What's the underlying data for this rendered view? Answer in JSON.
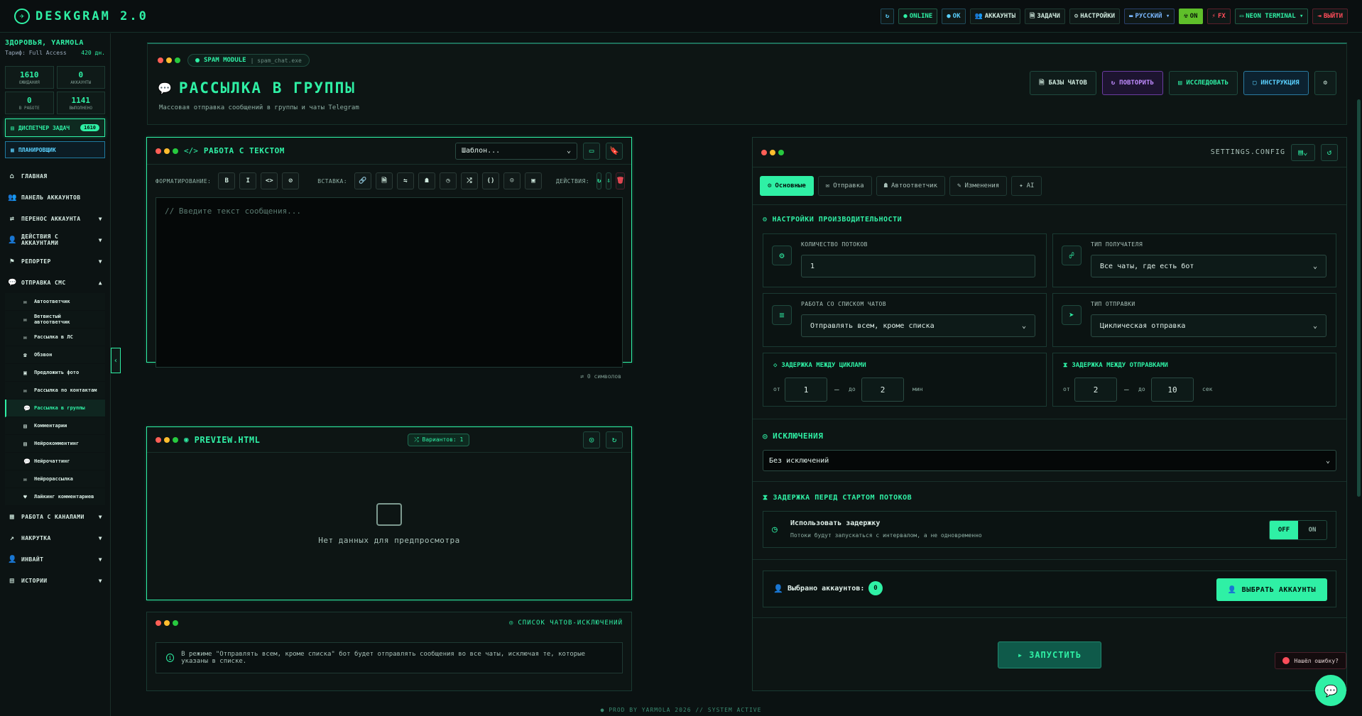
{
  "app": {
    "logo_mark": "✈",
    "title": "DESKGRAM 2.0"
  },
  "topbar": {
    "items": [
      {
        "icon": "↻",
        "label": "",
        "style": "blue",
        "name": "refresh-button"
      },
      {
        "icon": "●",
        "label": "ONLINE",
        "style": "green",
        "name": "online-status"
      },
      {
        "icon": "●",
        "label": "OK",
        "style": "blue",
        "name": "ok-status"
      },
      {
        "icon": "👥",
        "label": "АККАУНТЫ",
        "style": "",
        "name": "accounts-button"
      },
      {
        "icon": "🗎",
        "label": "ЗАДАЧИ",
        "style": "",
        "name": "tasks-button"
      },
      {
        "icon": "⚙",
        "label": "НАСТРОЙКИ",
        "style": "",
        "name": "settings-button"
      },
      {
        "icon": "▬",
        "label": "РУССКИЙ ▾",
        "style": "blue2",
        "name": "language-select"
      },
      {
        "icon": "☢",
        "label": "ON",
        "style": "lime",
        "name": "mode-toggle"
      },
      {
        "icon": "⚡",
        "label": "FX",
        "style": "red",
        "name": "fx-toggle"
      },
      {
        "icon": "▭",
        "label": "NEON TERMINAL ▾",
        "style": "green",
        "name": "theme-select"
      },
      {
        "icon": "⇥",
        "label": "ВЫЙТИ",
        "style": "red",
        "name": "logout-button"
      }
    ]
  },
  "sidebar": {
    "user_name": "ЗДОРОВЬЯ, YARMOLA",
    "plan": "Тариф: Full Access",
    "days": "420 дн.",
    "stats": [
      {
        "value": "1610",
        "label": "ОЖИДАНИЯ"
      },
      {
        "value": "0",
        "label": "АККАУНТЫ"
      },
      {
        "value": "0",
        "label": "В РАБОТЕ"
      },
      {
        "value": "1141",
        "label": "ВЫПОЛНЕНО"
      }
    ],
    "dispatcher": {
      "label": "ДИСПЕТЧЕР ЗАДАЧ",
      "badge": "1610"
    },
    "planner": {
      "label": "ПЛАНИРОВЩИК"
    },
    "nav_top": [
      {
        "icon": "⌂",
        "label": "ГЛАВНАЯ",
        "chevron": ""
      },
      {
        "icon": "👥",
        "label": "ПАНЕЛЬ АККАУНТОВ",
        "chevron": ""
      },
      {
        "icon": "⇄",
        "label": "ПЕРЕНОС АККАУНТА",
        "chevron": "▼"
      },
      {
        "icon": "👤",
        "label": "ДЕЙСТВИЯ С АККАУНТАМИ",
        "chevron": "▼"
      },
      {
        "icon": "⚑",
        "label": "РЕПОРТЕР",
        "chevron": "▼"
      },
      {
        "icon": "💬",
        "label": "ОТПРАВКА СМС",
        "chevron": "▲"
      }
    ],
    "sub_items": [
      {
        "icon": "✉",
        "label": "Автоответчик",
        "active": false
      },
      {
        "icon": "✉",
        "label": "Ветвистый автоответчик",
        "active": false
      },
      {
        "icon": "✉",
        "label": "Рассылка в ЛС",
        "active": false
      },
      {
        "icon": "☎",
        "label": "Обзвон",
        "active": false
      },
      {
        "icon": "▣",
        "label": "Предложить фото",
        "active": false
      },
      {
        "icon": "✉",
        "label": "Рассылка по контактам",
        "active": false
      },
      {
        "icon": "💬",
        "label": "Рассылка в группы",
        "active": true
      },
      {
        "icon": "▤",
        "label": "Комментарии",
        "active": false
      },
      {
        "icon": "▤",
        "label": "Нейрокомментинг",
        "active": false
      },
      {
        "icon": "💬",
        "label": "Нейрочаттинг",
        "active": false
      },
      {
        "icon": "✉",
        "label": "Нейрорассылка",
        "active": false
      },
      {
        "icon": "♥",
        "label": "Лайкинг комментариев",
        "active": false
      }
    ],
    "nav_bottom": [
      {
        "icon": "▦",
        "label": "РАБОТА С КАНАЛАМИ",
        "chevron": "▼"
      },
      {
        "icon": "↗",
        "label": "НАКРУТКА",
        "chevron": "▼"
      },
      {
        "icon": "👤",
        "label": "ИНВАЙТ",
        "chevron": "▼"
      },
      {
        "icon": "▤",
        "label": "ИСТОРИИ",
        "chevron": "▼"
      }
    ]
  },
  "header": {
    "module_label": "SPAM MODULE",
    "module_file": "spam_chat.exe",
    "title": "РАССЫЛКА В ГРУППЫ",
    "subtitle": "Массовая отправка сообщений в группы и чаты Telegram",
    "buttons": [
      {
        "icon": "🗎",
        "label": "БАЗЫ ЧАТОВ",
        "style": ""
      },
      {
        "icon": "↻",
        "label": "ПОВТОРИТЬ",
        "style": "purple"
      },
      {
        "icon": "▤",
        "label": "ИССЛЕДОВАТЬ",
        "style": "green"
      },
      {
        "icon": "▢",
        "label": "ИНСТРУКЦИЯ",
        "style": "blue"
      }
    ]
  },
  "editor": {
    "title": "РАБОТА С ТЕКСТОМ",
    "template_select": "Шаблон...",
    "format_label": "ФОРМАТИРОВАНИЕ:",
    "insert_label": "ВСТАВКА:",
    "actions_label": "ДЕЙСТВИЯ:",
    "format_buttons": [
      "B",
      "I",
      "<>",
      "⊘"
    ],
    "insert_buttons": [
      "🔗",
      "🗎",
      "⇋",
      "☗",
      "◷",
      "⤮",
      "()",
      "☺",
      "▣"
    ],
    "placeholder": "// Введите текст сообщения...",
    "counter": "0 символов"
  },
  "preview": {
    "title": "PREVIEW.HTML",
    "variants": "Вариантов: 1",
    "empty": "Нет данных для предпросмотра"
  },
  "exclusions_panel": {
    "title": "СПИСОК ЧАТОВ-ИСКЛЮЧЕНИЙ",
    "info": "В режиме \"Отправлять всем, кроме списка\" бот будет отправлять сообщения во все чаты, исключая те, которые указаны в списке."
  },
  "settings": {
    "header": "SETTINGS.CONFIG",
    "tabs": [
      {
        "icon": "⚙",
        "label": "Основные",
        "active": true
      },
      {
        "icon": "✉",
        "label": "Отправка",
        "active": false
      },
      {
        "icon": "☗",
        "label": "Автоответчик",
        "active": false
      },
      {
        "icon": "✎",
        "label": "Изменения",
        "active": false
      },
      {
        "icon": "✦",
        "label": "AI",
        "active": false
      }
    ],
    "perf_title": "НАСТРОЙКИ ПРОИЗВОДИТЕЛЬНОСТИ",
    "threads_label": "КОЛИЧЕСТВО ПОТОКОВ",
    "threads_value": "1",
    "recipient_label": "ТИП ПОЛУЧАТЕЛЯ",
    "recipient_value": "Все чаты, где есть бот",
    "chatlist_label": "РАБОТА СО СПИСКОМ ЧАТОВ",
    "chatlist_value": "Отправлять всем, кроме списка",
    "sendtype_label": "ТИП ОТПРАВКИ",
    "sendtype_value": "Циклическая отправка",
    "cycle_delay": {
      "title": "ЗАДЕРЖКА МЕЖДУ ЦИКЛАМИ",
      "from_label": "от",
      "from": "1",
      "to_label": "до",
      "to": "2",
      "unit": "мин"
    },
    "send_delay": {
      "title": "ЗАДЕРЖКА МЕЖДУ ОТПРАВКАМИ",
      "from_label": "от",
      "from": "2",
      "to_label": "до",
      "to": "10",
      "unit": "сек"
    },
    "exclusions_title": "ИСКЛЮЧЕНИЯ",
    "exclusions_value": "Без исключений",
    "start_delay_title": "ЗАДЕРЖКА ПЕРЕД СТАРТОМ ПОТОКОВ",
    "use_delay_label": "Использовать задержку",
    "use_delay_desc": "Потоки будут запускаться с интервалом, а не одновременно",
    "toggle_off": "OFF",
    "toggle_on": "ON",
    "selected_label": "Выбрано аккаунтов:",
    "selected_count": "0",
    "choose_button": "ВЫБРАТЬ АККАУНТЫ",
    "launch_button": "ЗАПУСТИТЬ"
  },
  "footer": "● PROD BY YARMOLA 2026   // SYSTEM ACTIVE",
  "bug_report": "Нашёл ошибку?",
  "colors": {
    "accent": "#2ff0a5",
    "bg": "#0b1212",
    "blue": "#5ad1ff",
    "purple": "#c08cff",
    "red": "#ff4d5a"
  }
}
